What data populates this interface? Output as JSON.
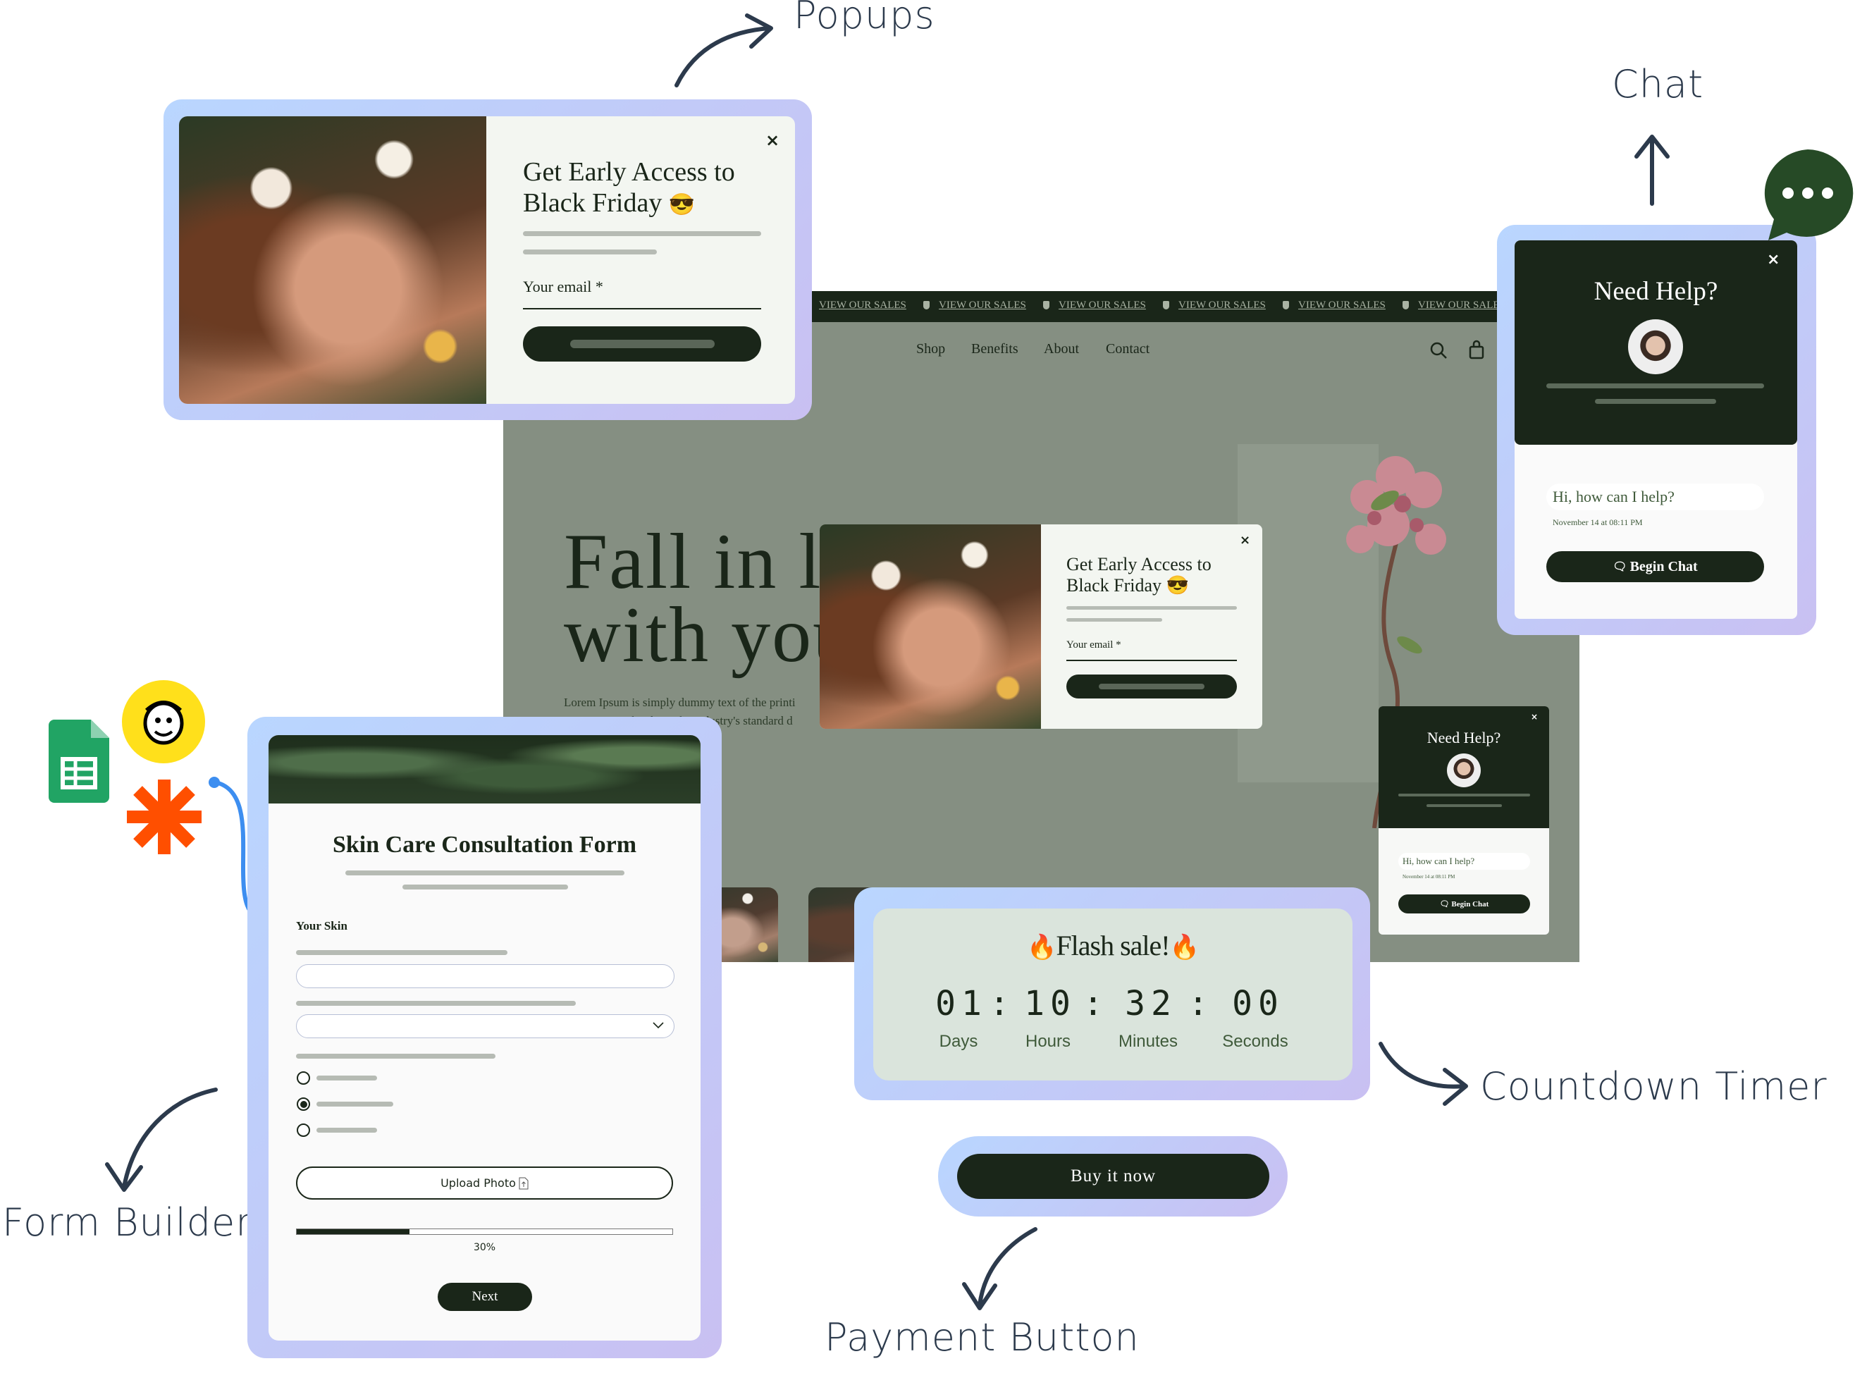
{
  "labels": {
    "popups": "Popups",
    "chat": "Chat",
    "countdown": "Countdown Timer",
    "form_builder": "Form Builder",
    "payment": "Payment Button"
  },
  "website": {
    "topbar_items": [
      "VIEW OUR SALES",
      "VIEW OUR SALES",
      "VIEW OUR SALES",
      "VIEW OUR SALES",
      "VIEW OUR SALES",
      "VIEW OUR SALES"
    ],
    "nav": [
      "Shop",
      "Benefits",
      "About",
      "Contact"
    ],
    "headline_1": "Fall in lo",
    "headline_2": "with you",
    "body_1": "Lorem Ipsum is simply dummy text of the printi",
    "body_2": "Lorem Ipsum has been the industry's standard d",
    "icons": [
      "search-icon",
      "bag-icon",
      "user-icon"
    ]
  },
  "popup": {
    "title_1": "Get Early Access to",
    "title_2": "Black Friday",
    "emoji": "😎",
    "email_label": "Your email *",
    "close": "×"
  },
  "chat": {
    "title": "Need Help?",
    "message": "Hi, how can I help?",
    "timestamp": "November 14 at 08:11 PM",
    "button": "Begin Chat",
    "close": "×"
  },
  "form": {
    "title": "Skin Care Consultation Form",
    "section": "Your Skin",
    "upload": "Upload Photo",
    "progress_label": "30%",
    "progress": 30,
    "next": "Next",
    "radio_selected": 1
  },
  "timer": {
    "title": "Flash sale!",
    "emoji": "🔥",
    "days": "01",
    "hours": "10",
    "minutes": "32",
    "seconds": "00",
    "sep": ":",
    "units": [
      "Days",
      "Hours",
      "Minutes",
      "Seconds"
    ]
  },
  "payment": {
    "button": "Buy it now"
  },
  "integrations": [
    "google-sheets-icon",
    "mailchimp-icon",
    "zapier-icon"
  ],
  "colors": {
    "brand_dark": "#1a2619",
    "site_bg": "#858f82",
    "frame_from": "#b9d6ff",
    "frame_to": "#c9c0f2",
    "timer_bg": "#dae4dc"
  }
}
